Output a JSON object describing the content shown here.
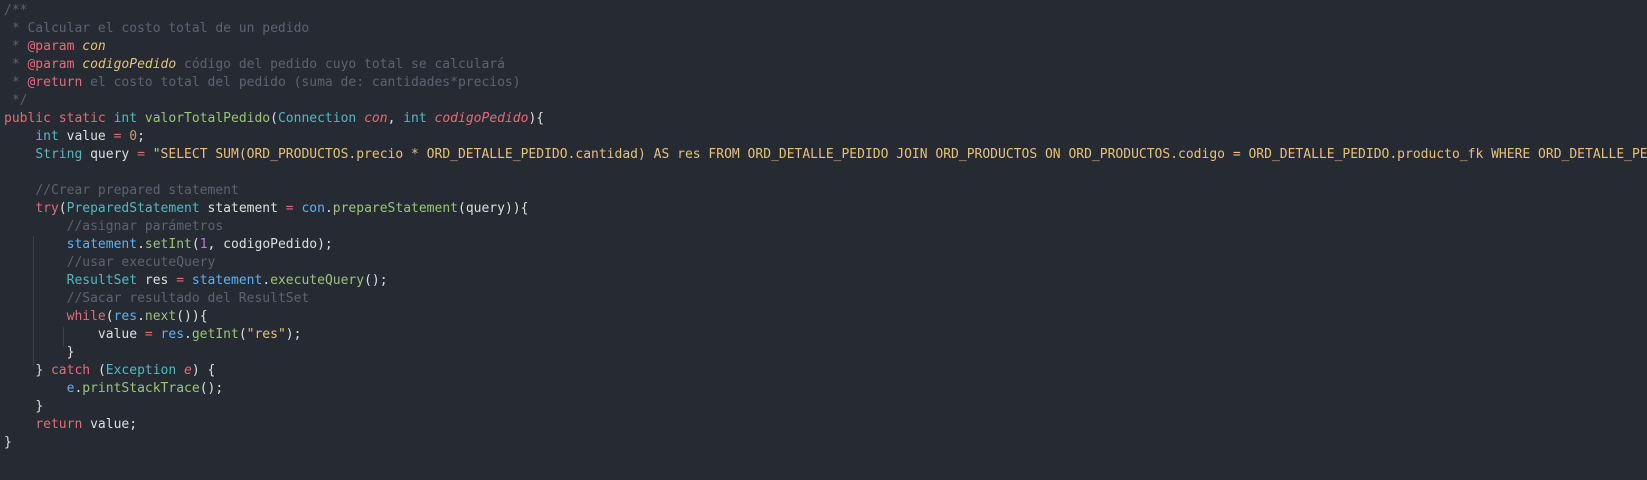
{
  "editor": {
    "comment": {
      "open": "/**",
      "line1": " * Calcular el costo total de un pedido",
      "line2_prefix": " * ",
      "line2_tag": "@param",
      "line2_name": "con",
      "line3_prefix": " * ",
      "line3_tag": "@param",
      "line3_name": "codigoPedido",
      "line3_desc": " código del pedido cuyo total se calculará",
      "line4_prefix": " * ",
      "line4_tag": "@return",
      "line4_desc": " el costo total del pedido (suma de: cantidades*precios)",
      "close": " */"
    },
    "sig": {
      "public": "public",
      "static": "static",
      "int": "int",
      "name": "valorTotalPedido",
      "open": "(",
      "ptype1": "Connection",
      "pname1": "con",
      "comma": ",",
      "ptype2": "int",
      "pname2": "codigoPedido",
      "close": "){"
    },
    "l7": {
      "type": "int",
      "name": "value",
      "eq": "=",
      "num": "0",
      "end": ";"
    },
    "l8": {
      "type": "String",
      "name": "query",
      "eq": "=",
      "str": "\"SELECT SUM(ORD_PRODUCTOS.precio * ORD_DETALLE_PEDIDO.cantidad) AS res FROM ORD_DETALLE_PEDIDO JOIN ORD_PRODUCTOS ON ORD_PRODUCTOS.codigo = ORD_DETALLE_PEDIDO.producto_fk WHERE ORD_DETALLE_PEDIDO.pedido_fk = ?\";"
    },
    "c10": "//Crear prepared statement",
    "l11": {
      "try": "try",
      "open": "(",
      "type": "PreparedStatement",
      "name": "statement",
      "eq": "=",
      "obj": "con",
      "dot": ".",
      "meth": "prepareStatement",
      "args": "(query)){"
    },
    "c12": "//asignar parámetros",
    "l13": {
      "obj": "statement",
      "dot": ".",
      "meth": "setInt",
      "open": "(",
      "num": "1",
      "rest": ", codigoPedido);"
    },
    "c14": "//usar executeQuery",
    "l15": {
      "type": "ResultSet",
      "name": "res",
      "eq": "=",
      "obj": "statement",
      "dot": ".",
      "meth": "executeQuery",
      "rest": "();"
    },
    "c16": "//Sacar resultado del ResultSet",
    "l17": {
      "kw": "while",
      "open": "(",
      "obj": "res",
      "dot": ".",
      "meth": "next",
      "rest": "()){"
    },
    "l18": {
      "name": "value",
      "eq": "=",
      "obj": "res",
      "dot": ".",
      "meth": "getInt",
      "open": "(",
      "str": "\"res\"",
      "rest": ");"
    },
    "l19": "}",
    "l20": {
      "close": "}",
      "kw": "catch",
      "open": "(",
      "type": "Exception",
      "name": "e",
      "rest": ") {"
    },
    "l21": {
      "obj": "e",
      "dot": ".",
      "meth": "printStackTrace",
      "rest": "();"
    },
    "l22": "}",
    "l23": {
      "kw": "return",
      "rest": "value;"
    },
    "l24": "}"
  }
}
